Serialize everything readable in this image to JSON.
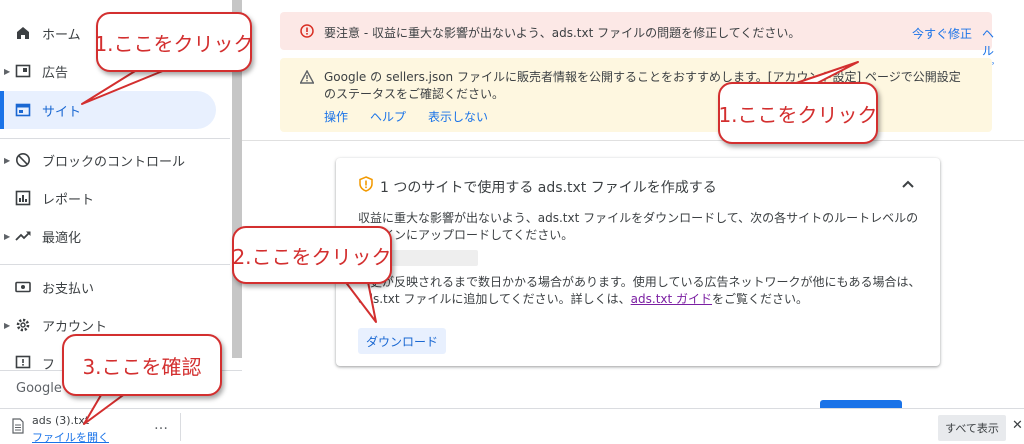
{
  "sidebar": {
    "items": [
      {
        "label": "ホーム",
        "icon": "home-icon"
      },
      {
        "label": "広告",
        "icon": "ads-icon"
      },
      {
        "label": "サイト",
        "icon": "sites-icon",
        "active": true
      },
      {
        "label": "ブロックのコントロール",
        "icon": "block-icon"
      },
      {
        "label": "レポート",
        "icon": "reports-icon"
      },
      {
        "label": "最適化",
        "icon": "optimization-icon"
      },
      {
        "label": "お支払い",
        "icon": "payments-icon"
      },
      {
        "label": "アカウント",
        "icon": "gear-icon"
      },
      {
        "label": "フ",
        "icon": "feedback-icon"
      }
    ],
    "footer_logo": "Google"
  },
  "banners": {
    "error": {
      "text": "要注意 - 収益に重大な影響が出ないよう、ads.txt ファイルの問題を修正してください。",
      "fix_now": "今すぐ修正",
      "help": "ヘルプ"
    },
    "warning": {
      "text": "Google の sellers.json ファイルに販売者情報を公開することをおすすめします。[アカウント設定] ページで公開設定のステータスをご確認ください。",
      "actions": [
        "操作",
        "ヘルプ",
        "表示しない"
      ]
    }
  },
  "card": {
    "title": "1 つのサイトで使用する ads.txt ファイルを作成する",
    "para1": "収益に重大な影響が出ないよう、ads.txt ファイルをダウンロードして、次の各サイトのルートレベルのドメインにアップロードしてください。",
    "para2_before": "変更が反映されるまで数日かかる場合があります。使用している広告ネットワークが他にもある場合は、ads.txt ファイルに追加してください。詳しくは、",
    "para2_link": "ads.txt ガイド",
    "para2_after": "をご覧ください。",
    "download_label": "ダウンロード"
  },
  "download_shelf": {
    "file_name": "ads (3).txt",
    "open_link": "ファイルを開く",
    "more": "…",
    "show_all": "すべて表示",
    "close": "✕"
  },
  "callouts": {
    "click_1_sidebar": "1.ここをクリック",
    "click_1_banner": "1.ここをクリック",
    "click_2": "2.ここをクリック",
    "check_3": "3.ここを確認"
  },
  "colors": {
    "accent": "#1a73e8",
    "annotation": "#d32f2f",
    "error_bg": "#fce8e6",
    "warning_bg": "#fef7e0",
    "active_bg": "#e8f0fe"
  }
}
